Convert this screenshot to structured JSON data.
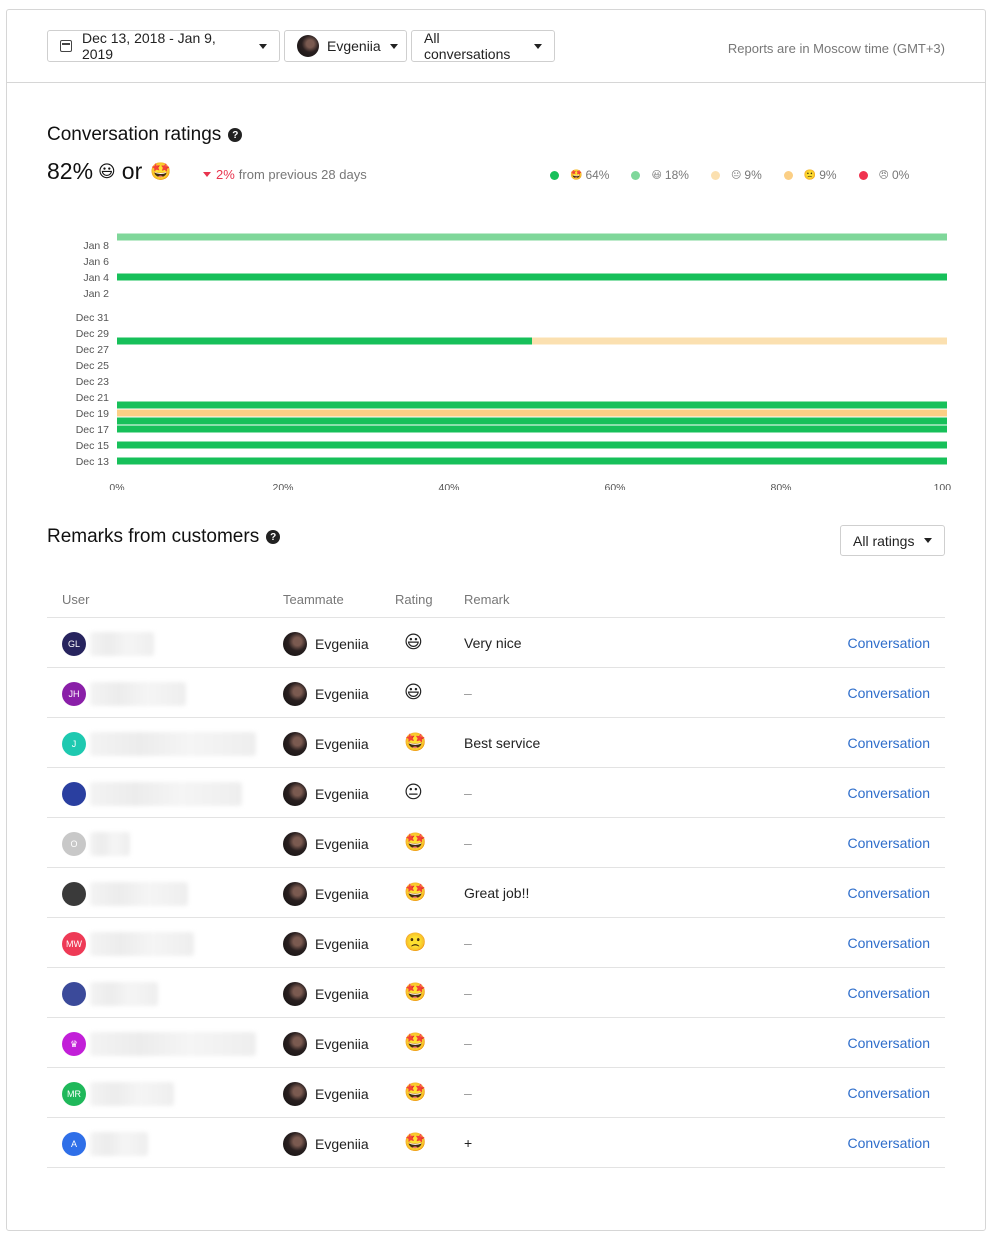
{
  "toolbar": {
    "date_range": "Dec 13, 2018 - Jan 9, 2019",
    "teammate": "Evgeniia",
    "conversations": "All conversations",
    "timezone_note": "Reports are in Moscow time (GMT+3)"
  },
  "ratings": {
    "title": "Conversation ratings",
    "help": "?",
    "big_value": "82%",
    "or": "or",
    "emoji_good": "😃",
    "emoji_great": "🤩",
    "delta_value": "2%",
    "delta_text": "from previous 28 days",
    "legend": [
      {
        "emoji": "🤩",
        "value": "64%",
        "color": "#17c05a"
      },
      {
        "emoji": "😃",
        "value": "18%",
        "color": "#7fd79a"
      },
      {
        "emoji": "😐",
        "value": "9%",
        "color": "#fbe0b0"
      },
      {
        "emoji": "🙁",
        "value": "9%",
        "color": "#fbcf85"
      },
      {
        "emoji": "😠",
        "value": "0%",
        "color": "#f0334f"
      }
    ]
  },
  "chart_data": {
    "type": "bar",
    "orientation": "horizontal",
    "stacked": true,
    "y_tick_labels": [
      "Jan 8",
      "Jan 6",
      "Jan 4",
      "Jan 2",
      "Dec 31",
      "Dec 29",
      "Dec 27",
      "Dec 25",
      "Dec 23",
      "Dec 21",
      "Dec 19",
      "Dec 17",
      "Dec 15",
      "Dec 13"
    ],
    "x_tick_labels": [
      "0%",
      "20%",
      "40%",
      "60%",
      "80%",
      "100%"
    ],
    "xlim": [
      0,
      100
    ],
    "grid": false,
    "rows": [
      {
        "date": "Jan 9",
        "segments": [
          {
            "color": "#7fd79a",
            "value": 100
          }
        ]
      },
      {
        "date": "Jan 4",
        "segments": [
          {
            "color": "#17c05a",
            "value": 100
          }
        ]
      },
      {
        "date": "Dec 28",
        "segments": [
          {
            "color": "#17c05a",
            "value": 50
          },
          {
            "color": "#fbe0b0",
            "value": 50
          }
        ]
      },
      {
        "date": "Dec 20",
        "segments": [
          {
            "color": "#17c05a",
            "value": 100
          }
        ]
      },
      {
        "date": "Dec 19",
        "segments": [
          {
            "color": "#fbcf85",
            "value": 100
          }
        ]
      },
      {
        "date": "Dec 18",
        "segments": [
          {
            "color": "#17c05a",
            "value": 100
          }
        ]
      },
      {
        "date": "Dec 17",
        "segments": [
          {
            "color": "#17c05a",
            "value": 100
          }
        ]
      },
      {
        "date": "Dec 15",
        "segments": [
          {
            "color": "#17c05a",
            "value": 100
          }
        ]
      },
      {
        "date": "Dec 13",
        "segments": [
          {
            "color": "#17c05a",
            "value": 100
          }
        ]
      }
    ]
  },
  "remarks": {
    "title": "Remarks from customers",
    "help": "?",
    "filter": "All ratings",
    "columns": {
      "user": "User",
      "teammate": "Teammate",
      "rating": "Rating",
      "remark": "Remark"
    },
    "rows": [
      {
        "initials": "GL",
        "avatar_color": "#27245e",
        "teammate": "Evgeniia",
        "rating": "😃",
        "remark": "Very nice",
        "link": "Conversation"
      },
      {
        "initials": "JH",
        "avatar_color": "#8a1fa8",
        "teammate": "Evgeniia",
        "rating": "😃",
        "remark": "–",
        "link": "Conversation"
      },
      {
        "initials": "J",
        "avatar_color": "#1ec9b0",
        "teammate": "Evgeniia",
        "rating": "🤩",
        "remark": "Best service",
        "link": "Conversation"
      },
      {
        "initials": "",
        "avatar_color": "#2a3fa0",
        "teammate": "Evgeniia",
        "rating": "😐",
        "remark": "–",
        "link": "Conversation"
      },
      {
        "initials": "O",
        "avatar_color": "#c8c8c8",
        "teammate": "Evgeniia",
        "rating": "🤩",
        "remark": "–",
        "link": "Conversation"
      },
      {
        "initials": "",
        "avatar_color": "#3a3a3a",
        "teammate": "Evgeniia",
        "rating": "🤩",
        "remark": "Great job!!",
        "link": "Conversation"
      },
      {
        "initials": "MW",
        "avatar_color": "#ee3a56",
        "teammate": "Evgeniia",
        "rating": "🙁",
        "remark": "–",
        "link": "Conversation"
      },
      {
        "initials": "",
        "avatar_color": "#3b4a9a",
        "teammate": "Evgeniia",
        "rating": "🤩",
        "remark": "–",
        "link": "Conversation"
      },
      {
        "initials": "♛",
        "avatar_color": "#c21fd8",
        "teammate": "Evgeniia",
        "rating": "🤩",
        "remark": "–",
        "link": "Conversation"
      },
      {
        "initials": "MR",
        "avatar_color": "#1fb85a",
        "teammate": "Evgeniia",
        "rating": "🤩",
        "remark": "–",
        "link": "Conversation"
      },
      {
        "initials": "A",
        "avatar_color": "#2f6fe8",
        "teammate": "Evgeniia",
        "rating": "🤩",
        "remark": "+",
        "link": "Conversation"
      }
    ]
  }
}
